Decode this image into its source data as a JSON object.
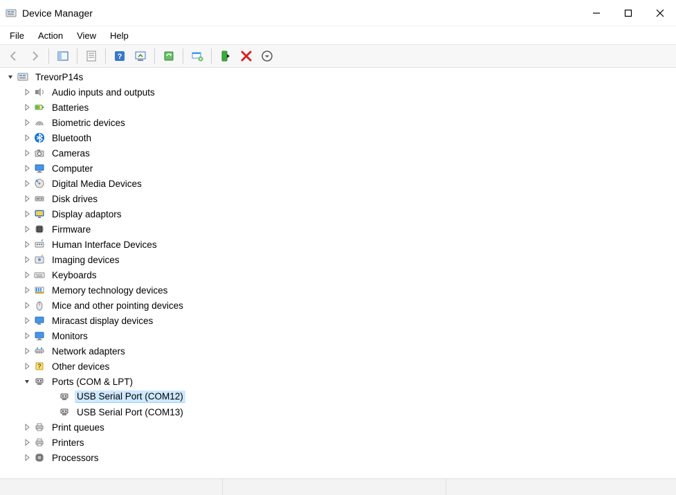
{
  "window": {
    "title": "Device Manager"
  },
  "menus": {
    "file": "File",
    "action": "Action",
    "view": "View",
    "help": "Help"
  },
  "toolbar": {
    "back": "Back",
    "forward": "Forward",
    "show_hide_tree": "Show/Hide Console Tree",
    "properties": "Properties",
    "help": "Help",
    "update_driver": "Update Driver Software",
    "scan": "Scan for hardware changes",
    "add_legacy": "Show hidden devices",
    "enable": "Enable Device",
    "uninstall": "Uninstall Device",
    "circle": "Action"
  },
  "tree": {
    "root": "TrevorP14s",
    "nodes": [
      {
        "label": "Audio inputs and outputs",
        "icon": "speaker"
      },
      {
        "label": "Batteries",
        "icon": "battery"
      },
      {
        "label": "Biometric devices",
        "icon": "fingerprint"
      },
      {
        "label": "Bluetooth",
        "icon": "bluetooth"
      },
      {
        "label": "Cameras",
        "icon": "camera"
      },
      {
        "label": "Computer",
        "icon": "monitor"
      },
      {
        "label": "Digital Media Devices",
        "icon": "media"
      },
      {
        "label": "Disk drives",
        "icon": "disk"
      },
      {
        "label": "Display adaptors",
        "icon": "display"
      },
      {
        "label": "Firmware",
        "icon": "chip"
      },
      {
        "label": "Human Interface Devices",
        "icon": "hid"
      },
      {
        "label": "Imaging devices",
        "icon": "imaging"
      },
      {
        "label": "Keyboards",
        "icon": "keyboard"
      },
      {
        "label": "Memory technology devices",
        "icon": "memory"
      },
      {
        "label": "Mice and other pointing devices",
        "icon": "mouse"
      },
      {
        "label": "Miracast display devices",
        "icon": "miracast"
      },
      {
        "label": "Monitors",
        "icon": "monitor"
      },
      {
        "label": "Network adapters",
        "icon": "network"
      },
      {
        "label": "Other devices",
        "icon": "other"
      },
      {
        "label": "Ports (COM & LPT)",
        "icon": "port",
        "expanded": true,
        "children": [
          {
            "label": "USB Serial Port (COM12)",
            "icon": "port",
            "selected": true
          },
          {
            "label": "USB Serial Port (COM13)",
            "icon": "port"
          }
        ]
      },
      {
        "label": "Print queues",
        "icon": "printer"
      },
      {
        "label": "Printers",
        "icon": "printer"
      },
      {
        "label": "Processors",
        "icon": "cpu"
      }
    ]
  }
}
